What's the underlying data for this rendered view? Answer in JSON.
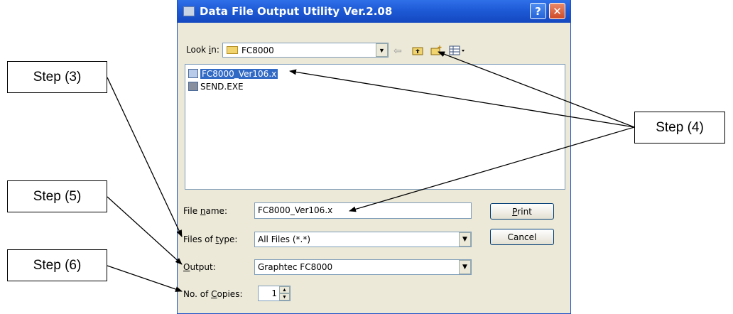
{
  "dialog": {
    "title": "Data File Output Utility Ver.2.08",
    "help_label": "?",
    "close_label": "✕",
    "lookin": {
      "label_prefix": "Look ",
      "label_accel": "i",
      "label_suffix": "n:",
      "value": "FC8000"
    },
    "toolbar_icons": [
      "back-arrow-icon",
      "up-folder-icon",
      "new-folder-icon",
      "view-menu-icon"
    ],
    "files": [
      {
        "name": "FC8000_Ver106.x",
        "selected": true
      },
      {
        "name": "SEND.EXE",
        "selected": false
      }
    ],
    "filename": {
      "label_prefix": "File ",
      "label_accel": "n",
      "label_suffix": "ame:",
      "value": "FC8000_Ver106.x"
    },
    "filetype": {
      "label_prefix": "Files of ",
      "label_accel": "t",
      "label_suffix": "ype:",
      "value": "All Files (*.*)"
    },
    "output": {
      "label_prefix": "",
      "label_accel": "O",
      "label_suffix": "utput:",
      "value": "Graphtec FC8000"
    },
    "copies": {
      "label_prefix": "No. of ",
      "label_accel": "C",
      "label_suffix": "opies:",
      "value": "1"
    },
    "print_button": {
      "accel": "P",
      "rest": "rint"
    },
    "cancel_button": "Cancel"
  },
  "callouts": {
    "step3": "Step (3)",
    "step4": "Step (4)",
    "step5": "Step (5)",
    "step6": "Step (6)"
  },
  "colors": {
    "title_bar": "#1e5ad6",
    "dialog_bg": "#ece9d8",
    "selection": "#316ac5"
  }
}
